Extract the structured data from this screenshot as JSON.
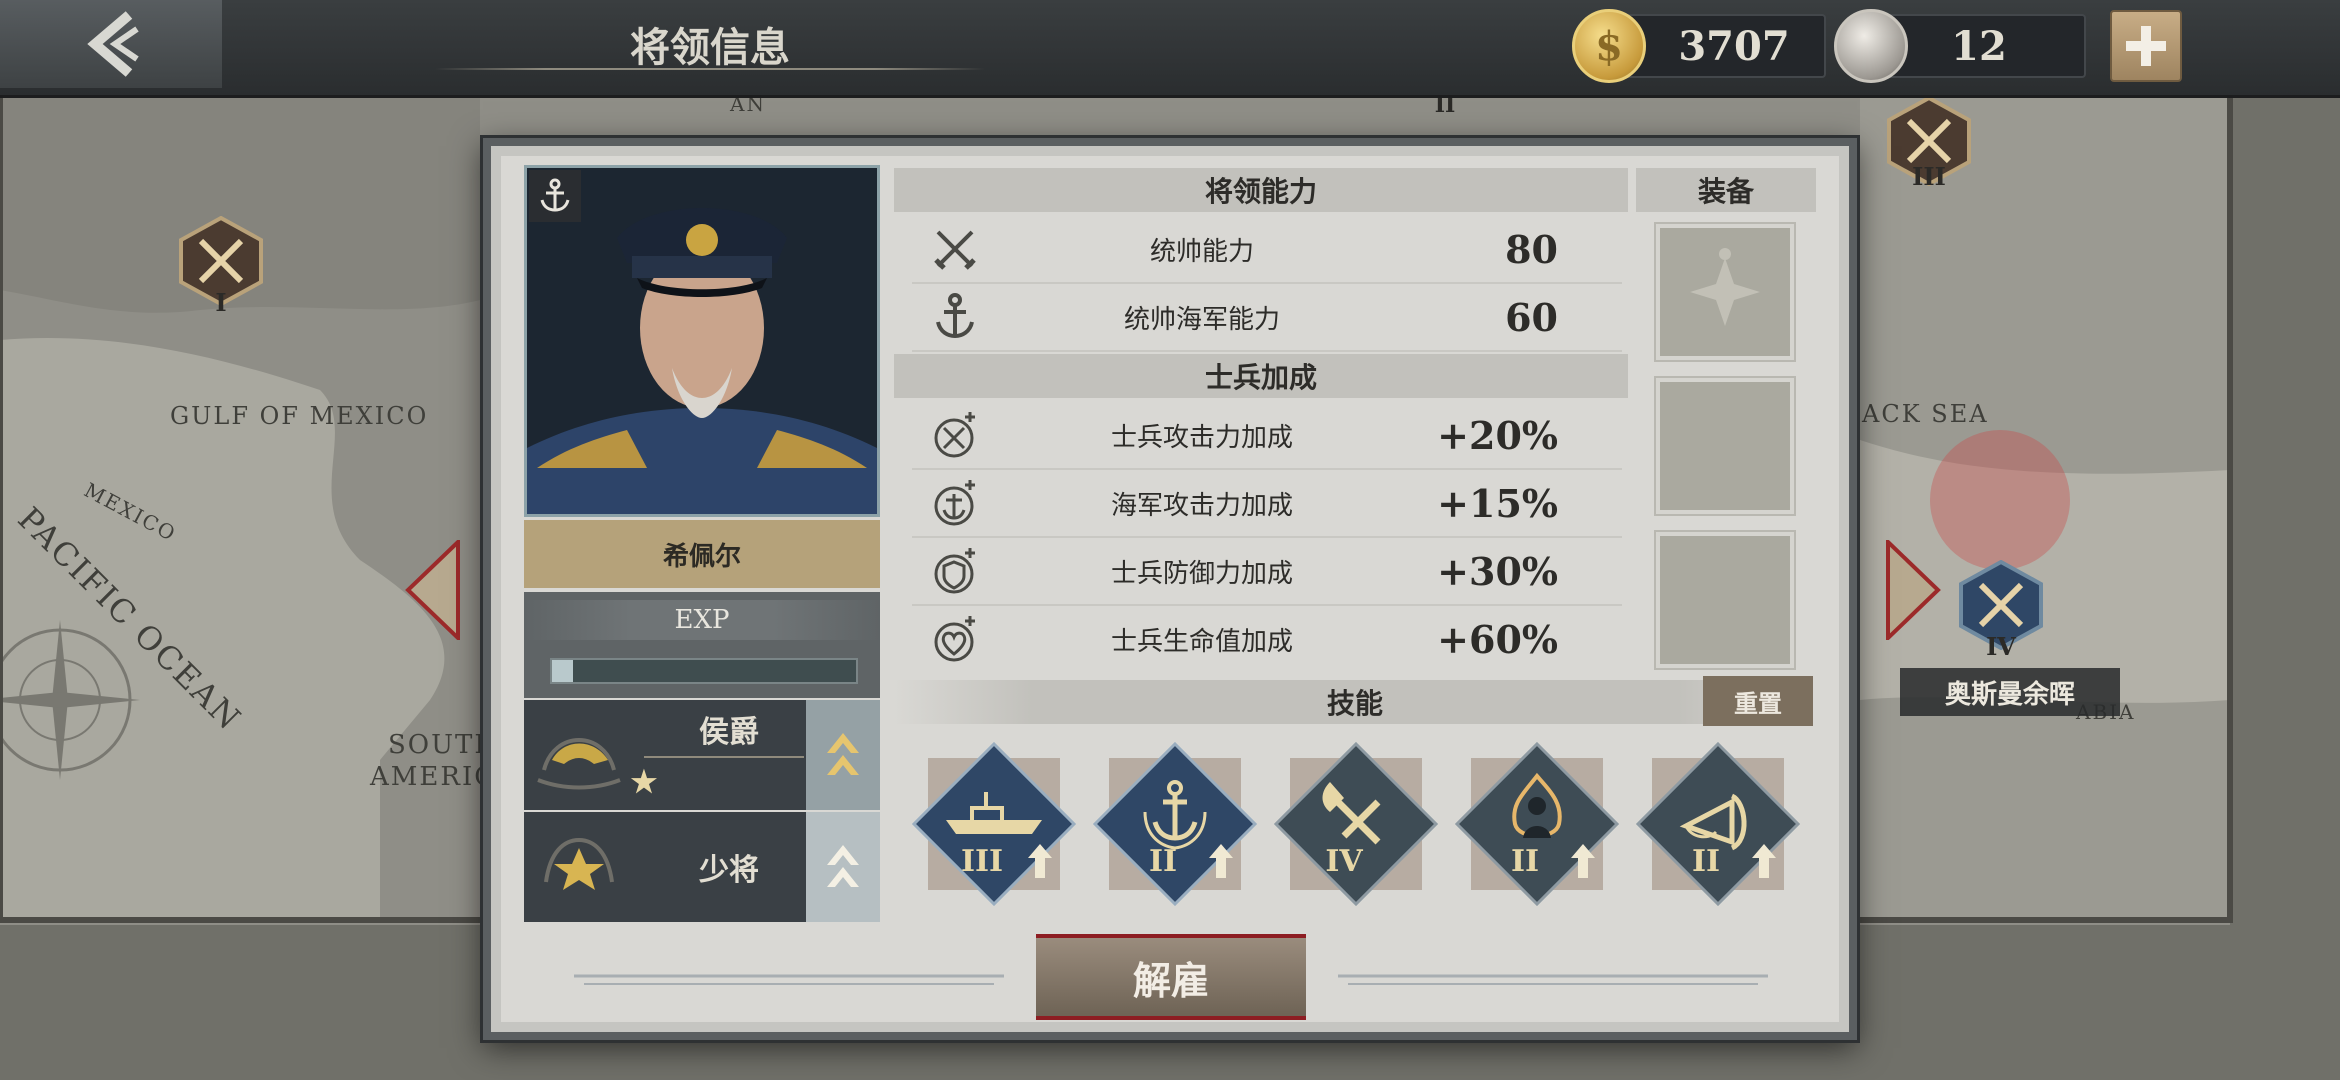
{
  "header": {
    "title": "将领信息",
    "gold": "3707",
    "medals": "12"
  },
  "map": {
    "labels": [
      "GULF OF MEXICO",
      "MEXICO",
      "PACIFIC OCEAN",
      "SOUTH",
      "AMERICA",
      "ACK SEA",
      "ABIA",
      "AN"
    ],
    "markers": [
      "I",
      "II",
      "III",
      "IV"
    ],
    "nation_label": "奥斯曼余晖"
  },
  "general": {
    "name": "希佩尔",
    "exp_label": "EXP",
    "exp_progress": 0.07,
    "title_rank": "侯爵",
    "title_stars": "★",
    "military_rank": "少将"
  },
  "ability": {
    "header": "将领能力",
    "stats": [
      {
        "name": "统帅能力",
        "value": "80",
        "icon": "crossed-swords-icon"
      },
      {
        "name": "统帅海军能力",
        "value": "60",
        "icon": "anchor-icon"
      }
    ]
  },
  "bonus": {
    "header": "士兵加成",
    "stats": [
      {
        "name": "士兵攻击力加成",
        "value": "+20%",
        "icon": "sword-plus-icon"
      },
      {
        "name": "海军攻击力加成",
        "value": "+15%",
        "icon": "anchor-plus-icon"
      },
      {
        "name": "士兵防御力加成",
        "value": "+30%",
        "icon": "shield-plus-icon"
      },
      {
        "name": "士兵生命值加成",
        "value": "+60%",
        "icon": "heart-plus-icon"
      }
    ]
  },
  "equipment": {
    "header": "装备",
    "slots": [
      "iron-cross-icon",
      "empty",
      "empty"
    ]
  },
  "skills": {
    "header": "技能",
    "reset_label": "重置",
    "items": [
      {
        "icon": "battleship-icon",
        "level": "III"
      },
      {
        "icon": "wreath-anchor-icon",
        "level": "II"
      },
      {
        "icon": "axe-hammer-icon",
        "level": "IV"
      },
      {
        "icon": "fire-soldier-icon",
        "level": "II"
      },
      {
        "icon": "bugle-icon",
        "level": "II"
      }
    ]
  },
  "actions": {
    "dismiss_label": "解雇"
  },
  "colors": {
    "navy": "#2f4766",
    "gold": "#c9b27a",
    "panel": "#d9d8d4",
    "danger": "#8d1d22"
  }
}
